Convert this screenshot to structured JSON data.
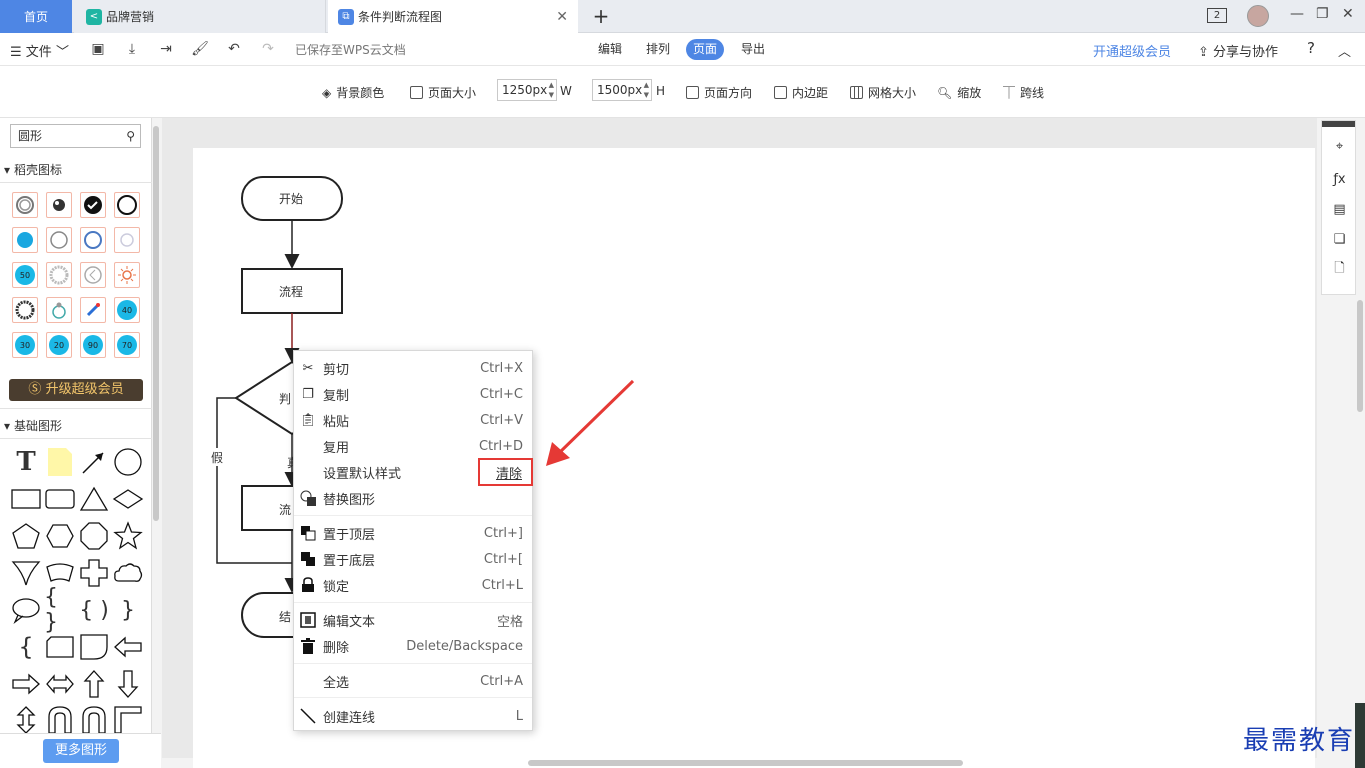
{
  "tabs": {
    "home": "首页",
    "tab1": "品牌营销",
    "tab2": "条件判断流程图",
    "new_tab": "+",
    "count": "2"
  },
  "toolbar": {
    "file": "文件",
    "saved": "已保存至WPS云文档",
    "modes": [
      "编辑",
      "排列",
      "页面",
      "导出"
    ],
    "active_mode": "页面",
    "vip": "开通超级会员",
    "share": "分享与协作",
    "help": "?"
  },
  "pagebar": {
    "bg_color": "背景颜色",
    "page_size": "页面大小",
    "width_value": "1250px",
    "width_unit": "W",
    "height_value": "1500px",
    "height_unit": "H",
    "orientation": "页面方向",
    "padding": "内边距",
    "grid": "网格大小",
    "zoom": "缩放",
    "line_jump": "跨线"
  },
  "left": {
    "search_value": "圆形",
    "section1": "稻壳图标",
    "badges": [
      "50",
      "40",
      "30",
      "20",
      "90",
      "70"
    ],
    "upgrade": "升级超级会员",
    "section2": "基础图形",
    "more": "更多图形"
  },
  "flow": {
    "start": "开始",
    "process": "流程",
    "decision": "判",
    "false_label": "假",
    "true_label": "真",
    "process2": "流",
    "end": "结"
  },
  "menu": {
    "items": [
      {
        "label": "剪切",
        "key": "Ctrl+X"
      },
      {
        "label": "复制",
        "key": "Ctrl+C"
      },
      {
        "label": "粘贴",
        "key": "Ctrl+V"
      },
      {
        "label": "复用",
        "key": "Ctrl+D"
      },
      {
        "label": "设置默认样式",
        "key": "清除"
      },
      {
        "label": "替换图形",
        "key": ""
      },
      {
        "label": "置于顶层",
        "key": "Ctrl+]"
      },
      {
        "label": "置于底层",
        "key": "Ctrl+["
      },
      {
        "label": "锁定",
        "key": "Ctrl+L"
      },
      {
        "label": "编辑文本",
        "key": "空格"
      },
      {
        "label": "删除",
        "key": "Delete/Backspace"
      },
      {
        "label": "全选",
        "key": "Ctrl+A"
      },
      {
        "label": "创建连线",
        "key": "L"
      }
    ]
  },
  "watermark": "最需教育",
  "colors": {
    "accent": "#4e86e4",
    "highlight_box": "#e53935",
    "arrow": "#e53935"
  }
}
